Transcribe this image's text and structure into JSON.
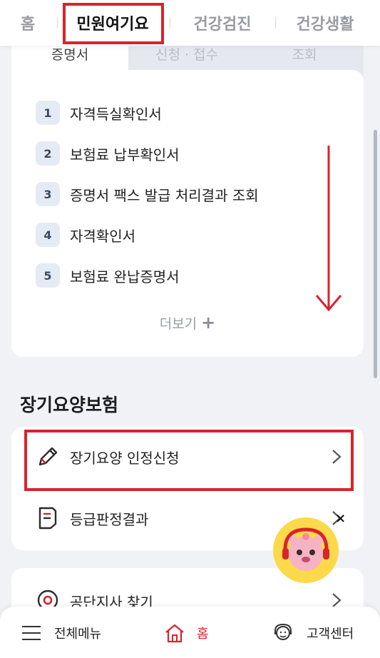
{
  "top_nav": {
    "tabs": [
      {
        "label": "홈",
        "active": false
      },
      {
        "label": "민원여기요",
        "active": true
      },
      {
        "label": "건강검진",
        "active": false
      },
      {
        "label": "건강생활",
        "active": false
      }
    ]
  },
  "sub_tabs": [
    {
      "label": "증명서",
      "active": true
    },
    {
      "label": "신청 · 접수",
      "active": false
    },
    {
      "label": "조회",
      "active": false
    }
  ],
  "documents": {
    "items": [
      {
        "num": "1",
        "label": "자격득실확인서"
      },
      {
        "num": "2",
        "label": "보험료 납부확인서"
      },
      {
        "num": "3",
        "label": "증명서 팩스 발급 처리결과 조회"
      },
      {
        "num": "4",
        "label": "자격확인서"
      },
      {
        "num": "5",
        "label": "보험료 완납증명서"
      }
    ],
    "more_label": "더보기",
    "more_icon": "plus-icon"
  },
  "long_term_care": {
    "title": "장기요양보험",
    "items": [
      {
        "label": "장기요양 인정신청",
        "icon": "pencil-icon"
      },
      {
        "label": "등급판정결과",
        "icon": "document-icon"
      }
    ]
  },
  "office": {
    "label": "공단지사 찾기",
    "icon": "location-icon"
  },
  "bottom_bar": {
    "menu_label": "전체메뉴",
    "home_label": "홈",
    "cs_label": "고객센터"
  },
  "colors": {
    "accent": "#d9232d",
    "number_badge_bg": "#e4ebf5",
    "background": "#f0f2f6"
  }
}
